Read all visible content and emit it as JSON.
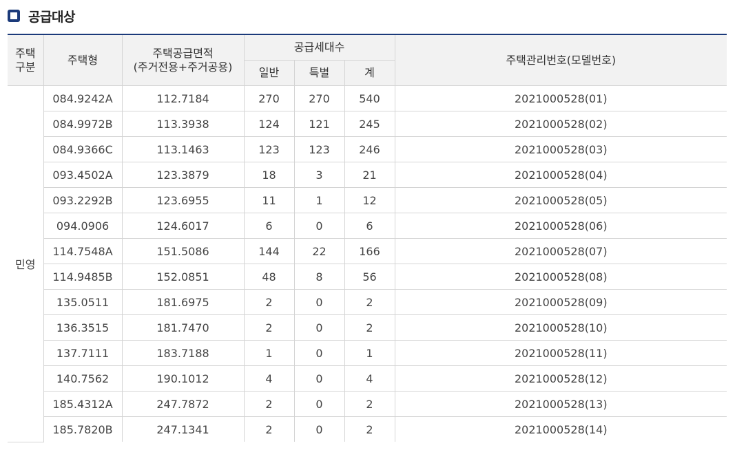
{
  "section": {
    "icon": "square-bullet-icon",
    "title": "공급대상"
  },
  "colors": {
    "accent": "#1b3a7a",
    "header_bg": "#f2f2f2",
    "border": "#d4d4d4"
  },
  "table": {
    "headers": {
      "category_line1": "주택",
      "category_line2": "구분",
      "type": "주택형",
      "area_line1": "주택공급면적",
      "area_line2": "(주거전용+주거공용)",
      "households": "공급세대수",
      "general": "일반",
      "special": "특별",
      "total": "계",
      "model_no": "주택관리번호(모델번호)"
    },
    "category": "민영",
    "rows": [
      {
        "type": "084.9242A",
        "area": "112.7184",
        "general": "270",
        "special": "270",
        "total": "540",
        "model": "2021000528(01)"
      },
      {
        "type": "084.9972B",
        "area": "113.3938",
        "general": "124",
        "special": "121",
        "total": "245",
        "model": "2021000528(02)"
      },
      {
        "type": "084.9366C",
        "area": "113.1463",
        "general": "123",
        "special": "123",
        "total": "246",
        "model": "2021000528(03)"
      },
      {
        "type": "093.4502A",
        "area": "123.3879",
        "general": "18",
        "special": "3",
        "total": "21",
        "model": "2021000528(04)"
      },
      {
        "type": "093.2292B",
        "area": "123.6955",
        "general": "11",
        "special": "1",
        "total": "12",
        "model": "2021000528(05)"
      },
      {
        "type": "094.0906",
        "area": "124.6017",
        "general": "6",
        "special": "0",
        "total": "6",
        "model": "2021000528(06)"
      },
      {
        "type": "114.7548A",
        "area": "151.5086",
        "general": "144",
        "special": "22",
        "total": "166",
        "model": "2021000528(07)"
      },
      {
        "type": "114.9485B",
        "area": "152.0851",
        "general": "48",
        "special": "8",
        "total": "56",
        "model": "2021000528(08)"
      },
      {
        "type": "135.0511",
        "area": "181.6975",
        "general": "2",
        "special": "0",
        "total": "2",
        "model": "2021000528(09)"
      },
      {
        "type": "136.3515",
        "area": "181.7470",
        "general": "2",
        "special": "0",
        "total": "2",
        "model": "2021000528(10)"
      },
      {
        "type": "137.7111",
        "area": "183.7188",
        "general": "1",
        "special": "0",
        "total": "1",
        "model": "2021000528(11)"
      },
      {
        "type": "140.7562",
        "area": "190.1012",
        "general": "4",
        "special": "0",
        "total": "4",
        "model": "2021000528(12)"
      },
      {
        "type": "185.4312A",
        "area": "247.7872",
        "general": "2",
        "special": "0",
        "total": "2",
        "model": "2021000528(13)"
      },
      {
        "type": "185.7820B",
        "area": "247.1341",
        "general": "2",
        "special": "0",
        "total": "2",
        "model": "2021000528(14)"
      }
    ]
  }
}
